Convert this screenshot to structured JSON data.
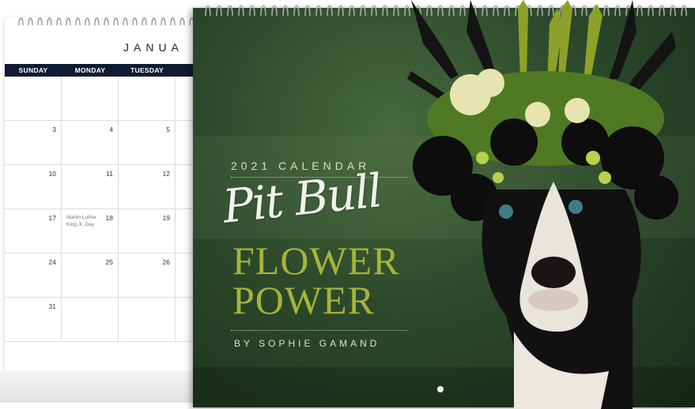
{
  "back_calendar": {
    "month_label": "JANUA",
    "day_headers": [
      "SUNDAY",
      "MONDAY",
      "TUESDAY",
      "W"
    ],
    "weeks": [
      [
        "",
        "",
        "",
        ""
      ],
      [
        "3",
        "4",
        "5",
        ""
      ],
      [
        "10",
        "11",
        "12",
        ""
      ],
      [
        "17",
        "18",
        "19",
        ""
      ],
      [
        "24",
        "25",
        "26",
        ""
      ],
      [
        "31",
        "",
        "",
        ""
      ]
    ],
    "holiday_note": "Martin Luther King Jr. Day"
  },
  "cover": {
    "kicker": "2021 CALENDAR",
    "script_title": "Pit Bull",
    "title_line1": "FLOWER",
    "title_line2": "POWER",
    "byline": "BY SOPHIE GAMAND",
    "colors": {
      "background": "#2c4a2b",
      "title_accent": "#a7b33a",
      "grid_header": "#0f1b33"
    },
    "photo_subject": "pit bull dog wearing a flower crown"
  }
}
